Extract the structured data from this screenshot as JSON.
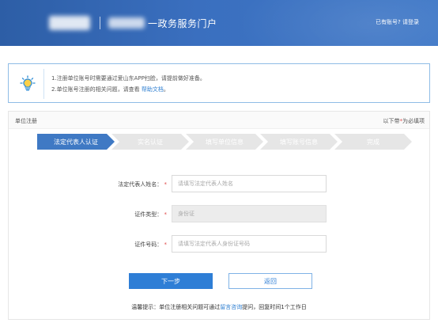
{
  "header": {
    "title": "一政务服务门户",
    "account_prompt": "已有账号? 请登录"
  },
  "notice": {
    "line1": "1.注册单位账号时需要通过爱山东APP扫脸，请提前做好准备。",
    "line2_prefix": "2.单位账号注册的相关问题，请查看",
    "line2_link": "帮助文档",
    "line2_suffix": "。"
  },
  "panel": {
    "title": "单位注册",
    "required_prefix": "以下带",
    "required_mark": "*",
    "required_suffix": "为必填项"
  },
  "steps": [
    {
      "label": "法定代表人认证",
      "active": true
    },
    {
      "label": "实名认证",
      "active": false
    },
    {
      "label": "填写单位信息",
      "active": false
    },
    {
      "label": "填写账号信息",
      "active": false
    },
    {
      "label": "完成",
      "active": false
    }
  ],
  "form": {
    "name_label": "法定代表人姓名：",
    "name_placeholder": "请填写法定代表人姓名",
    "idtype_label": "证件类型：",
    "idtype_value": "身份证",
    "idnum_label": "证件号码：",
    "idnum_placeholder": "请填写法定代表人身份证号码",
    "required_mark": "*"
  },
  "buttons": {
    "next": "下一步",
    "back": "返回"
  },
  "tip": {
    "prefix": "温馨提示：单位注册相关问题可通过",
    "link": "留言咨询",
    "suffix": "提问，回复时间1个工作日"
  },
  "colors": {
    "header_blue": "#3a6fbf",
    "active_step": "#3f79c4",
    "primary_button": "#2e7ed6",
    "required_red": "#e04b4b"
  },
  "icons": {
    "notice": "lightbulb-icon"
  }
}
